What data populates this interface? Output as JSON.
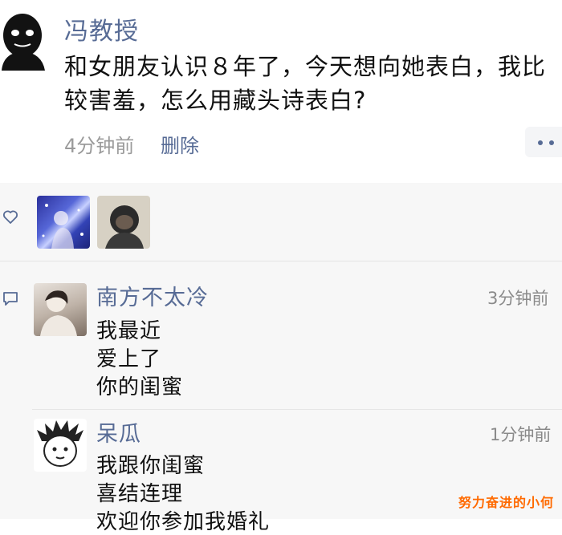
{
  "post": {
    "author": "冯教授",
    "text": "和女朋友认识８年了，今天想向她表白，我比较害羞，怎么用藏头诗表白?",
    "time": "4分钟前",
    "delete_label": "删除"
  },
  "comments": [
    {
      "name": "南方不太冷",
      "time": "3分钟前",
      "lines": [
        "我最近",
        "爱上了",
        "你的闺蜜"
      ]
    },
    {
      "name": "呆瓜",
      "time": "1分钟前",
      "lines": [
        "我跟你闺蜜",
        "喜结连理",
        "欢迎你参加我婚礼"
      ]
    }
  ],
  "watermark": "努力奋进的小何",
  "colors": {
    "link": "#576b95",
    "panel_bg": "#f7f7f7",
    "watermark": "#ff6a00"
  },
  "icons": {
    "like": "heart-icon",
    "comment": "comment-icon",
    "more": "more-dots-icon"
  }
}
